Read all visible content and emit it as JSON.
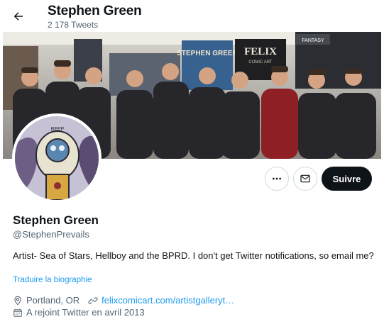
{
  "header": {
    "name": "Stephen Green",
    "tweet_count": "2 178 Tweets",
    "back_icon": "arrow-left-icon"
  },
  "banner": {
    "sign_left": "STEPHEN GREEN",
    "sign_right": "FELIX",
    "sign_right_sub": "COMIC ART",
    "sign_booth": "FANTASY"
  },
  "actions": {
    "more_icon": "ellipsis-icon",
    "mail_icon": "envelope-icon",
    "follow_label": "Suivre"
  },
  "profile": {
    "name": "Stephen Green",
    "handle": "@StephenPrevails",
    "bio": "Artist- Sea of Stars, Hellboy and the BPRD. I don't get Twitter notifications, so email me?",
    "translate_label": "Traduire la biographie",
    "location": "Portland, OR",
    "website": "felixcomicart.com/artistgalleryt…",
    "joined": "A rejoint Twitter en avril 2013"
  },
  "colors": {
    "accent": "#1d9bf0",
    "text": "#0f1419",
    "muted": "#536471",
    "follow_bg": "#0f1419"
  }
}
